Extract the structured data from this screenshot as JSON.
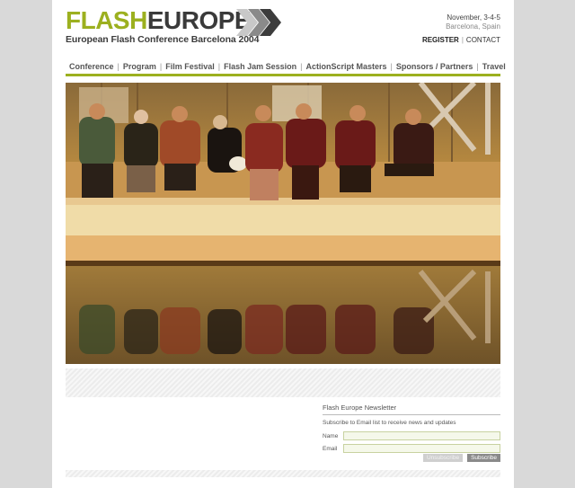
{
  "logo": {
    "part1": "FLASH",
    "part2": "EUROPE",
    "tagline": "European Flash Conference Barcelona 2004"
  },
  "event": {
    "date": "November, 3-4-5",
    "city": "Barcelona, Spain"
  },
  "top_links": {
    "register": "REGISTER",
    "separator": "|",
    "contact": "CONTACT"
  },
  "nav": {
    "items": [
      "Conference",
      "Program",
      "Film Festival",
      "Flash Jam Session",
      "ActionScript Masters",
      "Sponsors / Partners",
      "Travel"
    ],
    "separator": "|"
  },
  "newsletter": {
    "title": "Flash Europe Newsletter",
    "description": "Subscribe to Email list to receive news and updates",
    "name_label": "Name",
    "email_label": "Email",
    "unsubscribe_label": "Unsubscribe",
    "subscribe_label": "Subscribe"
  },
  "colors": {
    "brand_green": "#9cb01f",
    "dark": "#3a3a3a",
    "page_bg": "#d9d9d9"
  },
  "icons": {
    "logo_arrows": "chevron-arrows-icon"
  }
}
